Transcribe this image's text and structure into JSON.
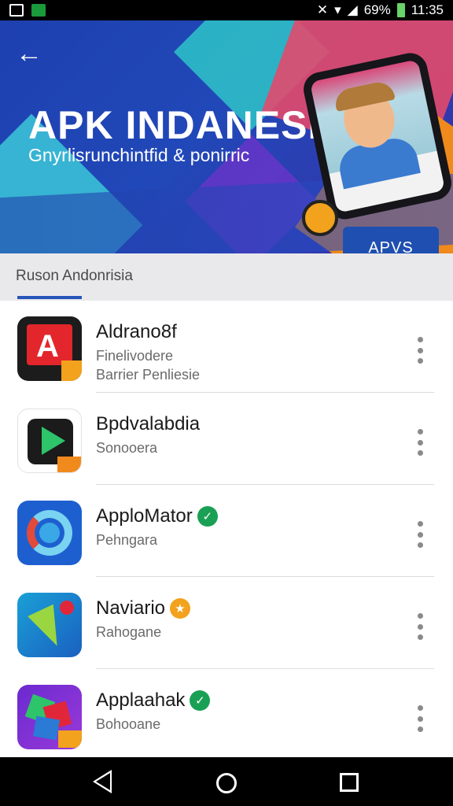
{
  "status_bar": {
    "battery_text": "69%",
    "time": "11:35",
    "icons": [
      "gallery-icon",
      "notification-icon",
      "mute-icon",
      "wifi-icon",
      "signal-icon",
      "battery-icon"
    ]
  },
  "banner": {
    "title": "APK INDANESII",
    "subtitle": "Gnyrlisrunchintfid & ponirric",
    "apps_button": "APVS",
    "colors": {
      "primary": "#2148b8",
      "accent_orange": "#f08a1d",
      "accent_teal": "#2ec4c8",
      "accent_pink": "#e24a6b"
    }
  },
  "tabs": {
    "active_label": "Ruson Andonrisia"
  },
  "apps": [
    {
      "name": "Aldrano8f",
      "line1": "Finelivodere",
      "line2": "Barrier Penliesie",
      "icon": "red-a-app-icon",
      "badge": ""
    },
    {
      "name": "Bpdvalabdia",
      "line1": "Sonooera",
      "line2": "",
      "icon": "play-store-icon",
      "badge": ""
    },
    {
      "name": "ApploMator",
      "line1": "Pehngara",
      "line2": "",
      "icon": "blue-ring-app-icon",
      "badge": "green-check-icon"
    },
    {
      "name": "Naviario",
      "line1": "Rahogane",
      "line2": "",
      "icon": "map-pin-app-icon",
      "badge": "orange-star-icon"
    },
    {
      "name": "Applaahak",
      "line1": "Bohooane",
      "line2": "",
      "icon": "gem-app-icon",
      "badge": "green-check-icon"
    }
  ],
  "nav": {
    "back": "back-icon",
    "home": "home-icon",
    "recents": "recents-icon"
  }
}
